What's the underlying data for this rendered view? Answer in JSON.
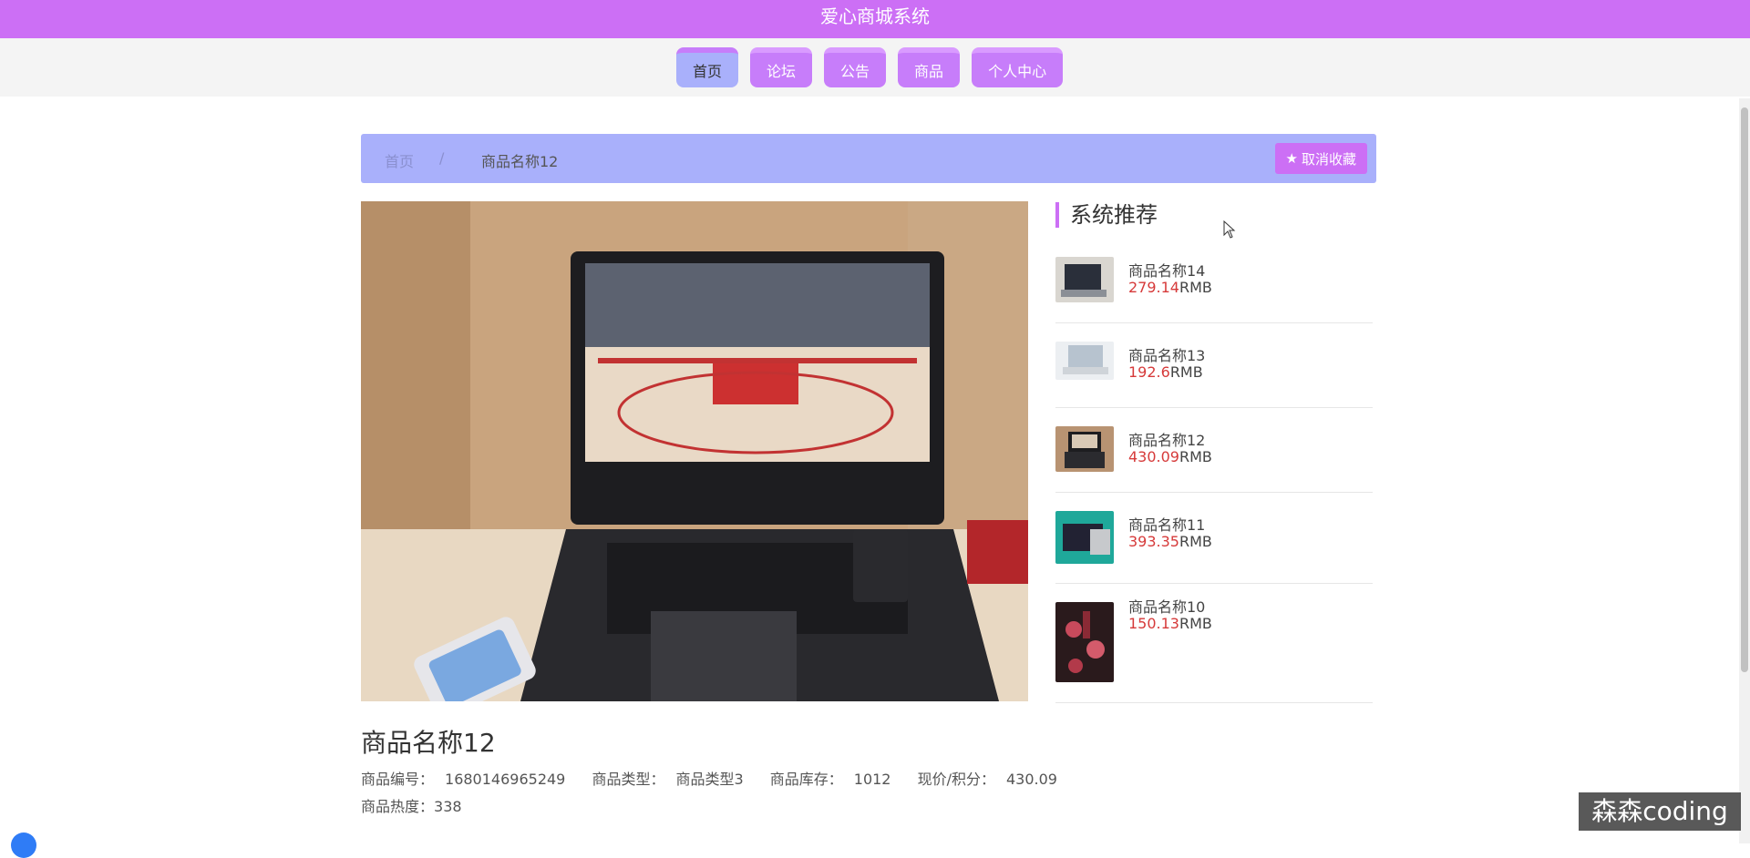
{
  "app": {
    "title": "爱心商城系统"
  },
  "nav": {
    "items": [
      {
        "label": "首页",
        "active": true
      },
      {
        "label": "论坛"
      },
      {
        "label": "公告"
      },
      {
        "label": "商品"
      },
      {
        "label": "个人中心"
      }
    ]
  },
  "breadcrumb": {
    "home": "首页",
    "separator": "/",
    "current": "商品名称12"
  },
  "actions": {
    "unfavorite_label": "取消收藏"
  },
  "product": {
    "name": "商品名称12",
    "code_label": "商品编号：",
    "code": "1680146965249",
    "type_label": "商品类型：",
    "type": "商品类型3",
    "stock_label": "商品库存：",
    "stock": "1012",
    "price_label": "现价/积分：",
    "price": "430.09",
    "heat_label": "商品热度：",
    "heat": "338"
  },
  "recommend": {
    "title": "系统推荐",
    "items": [
      {
        "name": "商品名称14",
        "price": "279.14",
        "unit": "RMB"
      },
      {
        "name": "商品名称13",
        "price": "192.6",
        "unit": "RMB"
      },
      {
        "name": "商品名称12",
        "price": "430.09",
        "unit": "RMB"
      },
      {
        "name": "商品名称11",
        "price": "393.35",
        "unit": "RMB"
      },
      {
        "name": "商品名称10",
        "price": "150.13",
        "unit": "RMB"
      }
    ]
  },
  "watermark": "森森coding",
  "colors": {
    "accent": "#cc6ff5",
    "breadcrumb_bg": "#a9b0fb",
    "price": "#d63a3a"
  }
}
